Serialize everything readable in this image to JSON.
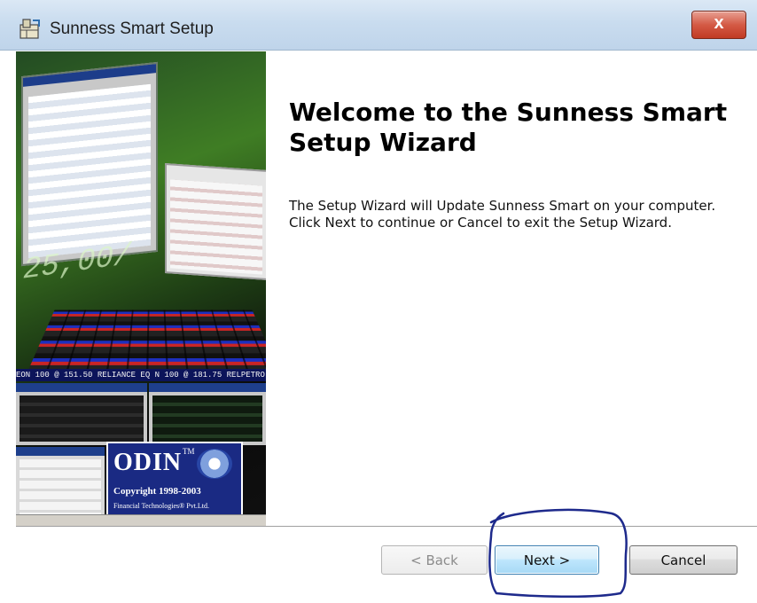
{
  "window": {
    "title": "Sunness Smart Setup",
    "close_label": "x"
  },
  "banner": {
    "big_number": "25,00/",
    "ticker": "EON 100 @ 151.50  RELIANCE EQ N 100 @ 181.75  RELPETRO",
    "odin": {
      "logo": "ODIN",
      "trademark": "TM",
      "copyright": "Copyright 1998-2003",
      "company": "Financial Technologies® Pvt.Ltd."
    }
  },
  "content": {
    "heading": "Welcome to the Sunness Smart Setup Wizard",
    "body": "The Setup Wizard will Update Sunness Smart on your computer.  Click Next to continue or Cancel to exit the Setup Wizard."
  },
  "buttons": {
    "back": "< Back",
    "next": "Next >",
    "cancel": "Cancel"
  },
  "colors": {
    "titlebar": "#c9dcef",
    "close": "#c13a23",
    "annotation": "#1e2a8c"
  }
}
